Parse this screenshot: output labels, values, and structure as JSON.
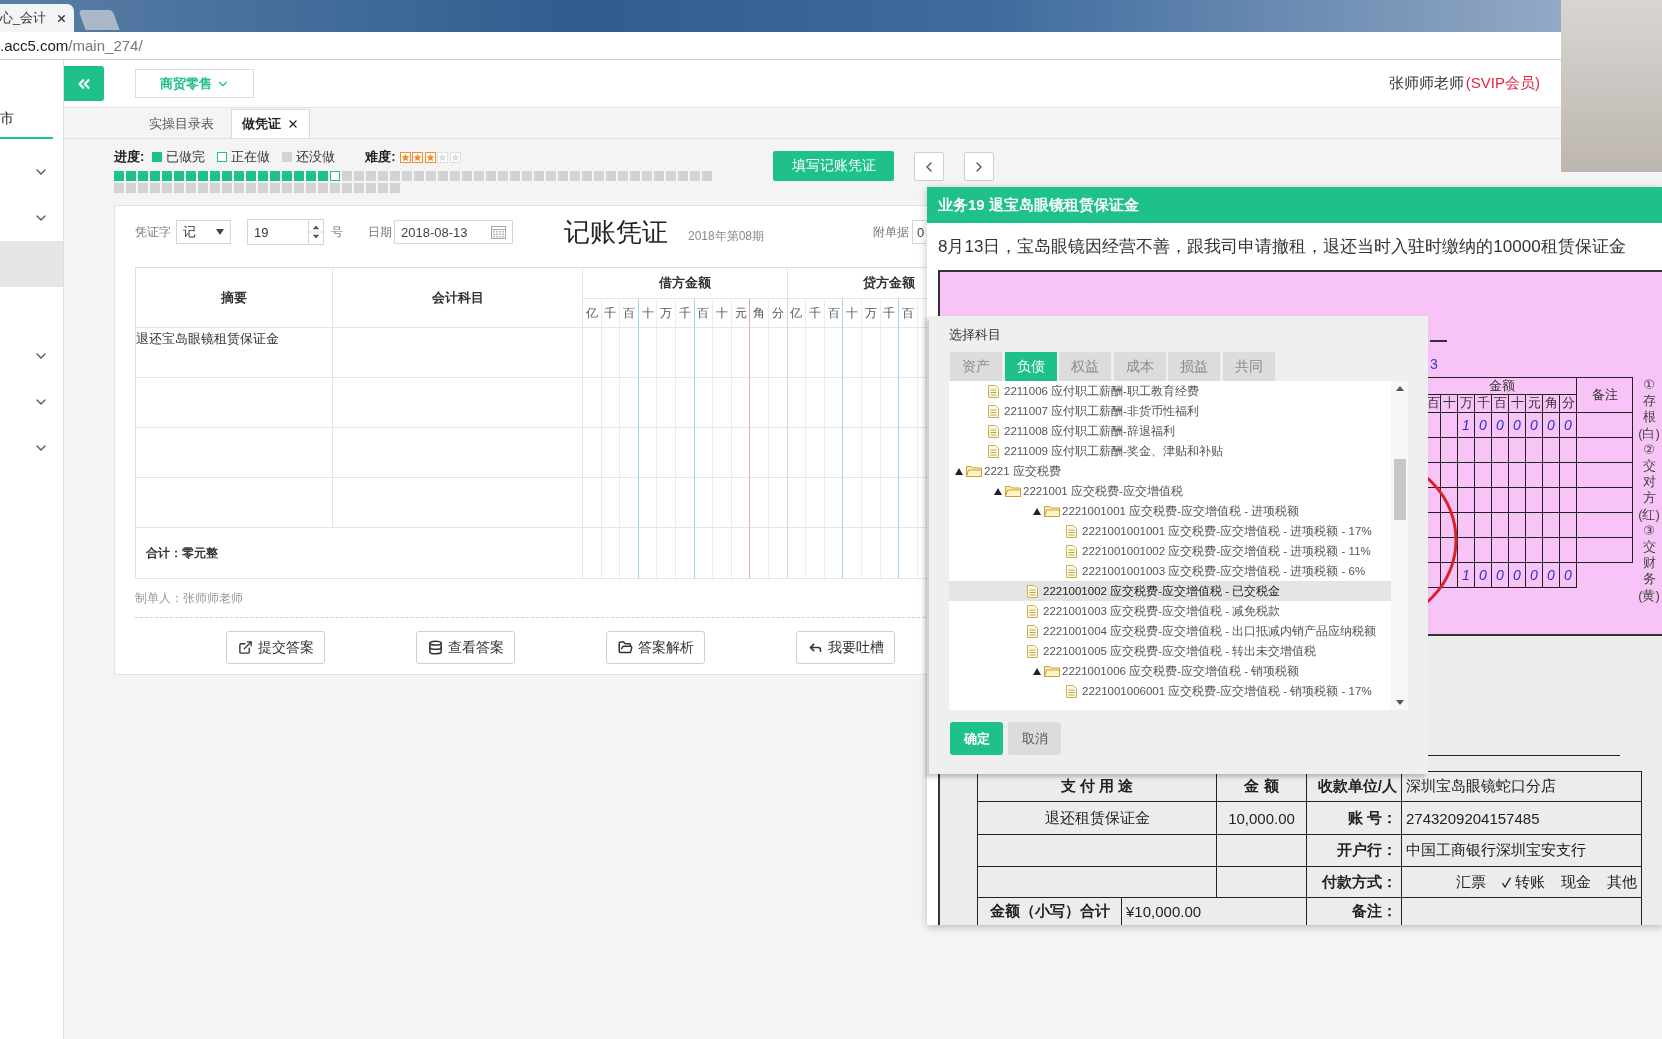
{
  "browser": {
    "tab_title": "心_会计",
    "address_domain": ".acc5.com",
    "address_path": "/main_274/"
  },
  "sidebar": {
    "heading": "市",
    "items": [
      {
        "kind": "group",
        "expanded": false,
        "selected": false
      },
      {
        "kind": "group",
        "expanded": false,
        "selected": false
      },
      {
        "kind": "link",
        "selected": true
      },
      {
        "kind": "group",
        "expanded": false,
        "selected": false
      },
      {
        "kind": "group",
        "expanded": false,
        "selected": false
      },
      {
        "kind": "group",
        "expanded": false,
        "selected": false
      }
    ]
  },
  "header": {
    "industry": "商贸零售",
    "user_name": "张师师老师",
    "user_level": "(SVIP会员)"
  },
  "tabs": [
    {
      "label": "实操目录表",
      "selected": false,
      "closable": false
    },
    {
      "label": "做凭证",
      "selected": true,
      "closable": true
    }
  ],
  "progress": {
    "label": "进度:",
    "legend": [
      {
        "kind": "done",
        "label": "已做完"
      },
      {
        "kind": "current",
        "label": "正在做"
      },
      {
        "kind": "todo",
        "label": "还没做"
      }
    ],
    "steps": [
      {
        "kind": "done"
      },
      {
        "kind": "done"
      },
      {
        "kind": "done"
      },
      {
        "kind": "done"
      },
      {
        "kind": "done"
      },
      {
        "kind": "done"
      },
      {
        "kind": "done"
      },
      {
        "kind": "done"
      },
      {
        "kind": "done"
      },
      {
        "kind": "done"
      },
      {
        "kind": "done"
      },
      {
        "kind": "done"
      },
      {
        "kind": "done"
      },
      {
        "kind": "done"
      },
      {
        "kind": "done"
      },
      {
        "kind": "done"
      },
      {
        "kind": "done"
      },
      {
        "kind": "done"
      },
      {
        "kind": "current"
      },
      {
        "kind": "todo"
      },
      {
        "kind": "todo"
      },
      {
        "kind": "todo"
      },
      {
        "kind": "todo"
      },
      {
        "kind": "todo"
      },
      {
        "kind": "todo"
      },
      {
        "kind": "todo"
      },
      {
        "kind": "todo"
      },
      {
        "kind": "todo"
      },
      {
        "kind": "todo"
      },
      {
        "kind": "todo"
      },
      {
        "kind": "todo"
      },
      {
        "kind": "todo"
      },
      {
        "kind": "todo"
      },
      {
        "kind": "todo"
      },
      {
        "kind": "todo"
      },
      {
        "kind": "todo"
      },
      {
        "kind": "todo"
      },
      {
        "kind": "todo"
      },
      {
        "kind": "todo"
      },
      {
        "kind": "todo"
      },
      {
        "kind": "todo"
      },
      {
        "kind": "todo"
      },
      {
        "kind": "todo"
      },
      {
        "kind": "todo"
      },
      {
        "kind": "todo"
      },
      {
        "kind": "todo"
      },
      {
        "kind": "todo"
      },
      {
        "kind": "todo"
      },
      {
        "kind": "todo"
      },
      {
        "kind": "todo"
      },
      {
        "kind": "todo"
      },
      {
        "kind": "todo"
      },
      {
        "kind": "todo"
      },
      {
        "kind": "todo"
      },
      {
        "kind": "todo"
      },
      {
        "kind": "todo"
      },
      {
        "kind": "todo"
      },
      {
        "kind": "todo"
      },
      {
        "kind": "todo"
      },
      {
        "kind": "todo"
      },
      {
        "kind": "todo"
      },
      {
        "kind": "todo"
      },
      {
        "kind": "todo"
      },
      {
        "kind": "todo"
      },
      {
        "kind": "todo"
      },
      {
        "kind": "todo"
      },
      {
        "kind": "todo"
      },
      {
        "kind": "todo"
      },
      {
        "kind": "todo"
      },
      {
        "kind": "todo"
      },
      {
        "kind": "todo"
      },
      {
        "kind": "todo"
      },
      {
        "kind": "todo"
      },
      {
        "kind": "todo"
      }
    ],
    "difficulty_label": "难度:",
    "stars": 3
  },
  "actions": {
    "fill_button": "填写记账凭证"
  },
  "voucher": {
    "type_label": "凭证字",
    "type_value": "记",
    "number": "19",
    "number_suffix": "号",
    "date_label": "日期",
    "date": "2018-08-13",
    "title": "记账凭证",
    "period": "2018年第08期",
    "attachments_label": "附单据",
    "attachments": "0",
    "columns": {
      "summary": "摘要",
      "account": "会计科目",
      "debit": "借方金额",
      "credit": "贷方金额",
      "debit_digits": [
        "亿",
        "千",
        "百",
        "十",
        "万",
        "千",
        "百",
        "十",
        "元",
        "角",
        "分"
      ],
      "credit_digits": [
        "亿",
        "千",
        "百",
        "十",
        "万",
        "千",
        "百"
      ]
    },
    "rows": [
      {
        "summary": "退还宝岛眼镜租赁保证金"
      },
      {},
      {},
      {}
    ],
    "total": "合计：零元整",
    "preparer": "制单人：张师师老师",
    "buttons": [
      {
        "kind": "submit",
        "label": "提交答案"
      },
      {
        "kind": "view",
        "label": "查看答案"
      },
      {
        "kind": "analysis",
        "label": "答案解析"
      },
      {
        "kind": "feedback",
        "label": "我要吐槽"
      }
    ]
  },
  "business": {
    "title": "业务19 退宝岛眼镜租赁保证金",
    "description": "8月13日，宝岛眼镜因经营不善，跟我司申请撤租，退还当时入驻时缴纳的10000租赁保证金",
    "receipt": {
      "date_fragment": "3",
      "amount_heading": "金额",
      "digits": [
        "百",
        "十",
        "万",
        "千",
        "百",
        "十",
        "元",
        "角",
        "分"
      ],
      "remark_heading": "备注",
      "rows": [
        {
          "values": [
            "1",
            "0",
            "0",
            "0",
            "0",
            "0",
            "0"
          ]
        },
        {},
        {},
        {},
        {},
        {}
      ],
      "total": {
        "values": [
          "1",
          "0",
          "0",
          "0",
          "0",
          "0",
          "0"
        ]
      },
      "copies": "①存根(白)②交对方(红)③交财务(黄)"
    },
    "payment_form": {
      "purpose_heading": "支 付 用 途",
      "amount_heading": "金 额",
      "payee_label": "收款单位/人",
      "payee": "深圳宝岛眼镜蛇口分店",
      "purpose": "退还租赁保证金",
      "amount": "10,000.00",
      "account_label": "账 号：",
      "account": "2743209204157485",
      "bank_label": "开户行：",
      "bank": "中国工商银行深圳宝安支行",
      "method_label": "付款方式：",
      "methods": [
        {
          "label": "汇票",
          "checked": false
        },
        {
          "label": "转账",
          "checked": true
        },
        {
          "label": "现金",
          "checked": false
        },
        {
          "label": "其他",
          "checked": false
        }
      ],
      "total_label": "金额（小写）合计",
      "total": "¥10,000.00",
      "remark_label": "备注："
    }
  },
  "dialog": {
    "title": "选择科目",
    "tabs": [
      {
        "label": "资产",
        "selected": false
      },
      {
        "label": "负债",
        "selected": true
      },
      {
        "label": "权益",
        "selected": false
      },
      {
        "label": "成本",
        "selected": false
      },
      {
        "label": "损益",
        "selected": false
      },
      {
        "label": "共同",
        "selected": false
      }
    ],
    "tree": [
      {
        "children": [
          {
            "kind": "leaf",
            "label": "2211006 应付职工薪酬-职工教育经费",
            "selected": false
          },
          {
            "kind": "leaf",
            "label": "2211007 应付职工薪酬-非货币性福利",
            "selected": false
          },
          {
            "kind": "leaf",
            "label": "2211008 应付职工薪酬-辞退福利",
            "selected": false
          },
          {
            "kind": "leaf",
            "label": "2211009 应付职工薪酬-奖金、津贴和补贴",
            "selected": false
          }
        ]
      },
      {
        "kind": "folder",
        "label": "2221 应交税费",
        "expanded": true,
        "selected": false,
        "children": [
          {
            "kind": "folder",
            "label": "2221001 应交税费-应交增值税",
            "expanded": true,
            "selected": false,
            "children": [
              {
                "kind": "folder",
                "label": "2221001001 应交税费-应交增值税 - 进项税额",
                "expanded": true,
                "selected": false,
                "children": [
                  {
                    "kind": "leaf",
                    "label": "2221001001001 应交税费-应交增值税 - 进项税额 - 17%",
                    "selected": false
                  },
                  {
                    "kind": "leaf",
                    "label": "2221001001002 应交税费-应交增值税 - 进项税额 - 11%",
                    "selected": false
                  },
                  {
                    "kind": "leaf",
                    "label": "2221001001003 应交税费-应交增值税 - 进项税额 - 6%",
                    "selected": false
                  }
                ]
              },
              {
                "kind": "leaf",
                "label": "2221001002 应交税费-应交增值税 - 已交税金",
                "selected": true
              },
              {
                "kind": "leaf",
                "label": "2221001003 应交税费-应交增值税 - 减免税款",
                "selected": false
              },
              {
                "kind": "leaf",
                "label": "2221001004 应交税费-应交增值税 - 出口抵减内销产品应纳税额",
                "selected": false
              },
              {
                "kind": "leaf",
                "label": "2221001005 应交税费-应交增值税 - 转出未交增值税",
                "selected": false
              },
              {
                "kind": "folder",
                "label": "2221001006 应交税费-应交增值税 - 销项税额",
                "expanded": true,
                "selected": false,
                "children": [
                  {
                    "kind": "leaf",
                    "label": "2221001006001 应交税费-应交增值税 - 销项税额 - 17%",
                    "selected": false
                  }
                ]
              }
            ]
          }
        ]
      }
    ],
    "buttons": [
      {
        "kind": "primary",
        "label": "确定"
      },
      {
        "kind": "secondary",
        "label": "取消"
      }
    ]
  }
}
